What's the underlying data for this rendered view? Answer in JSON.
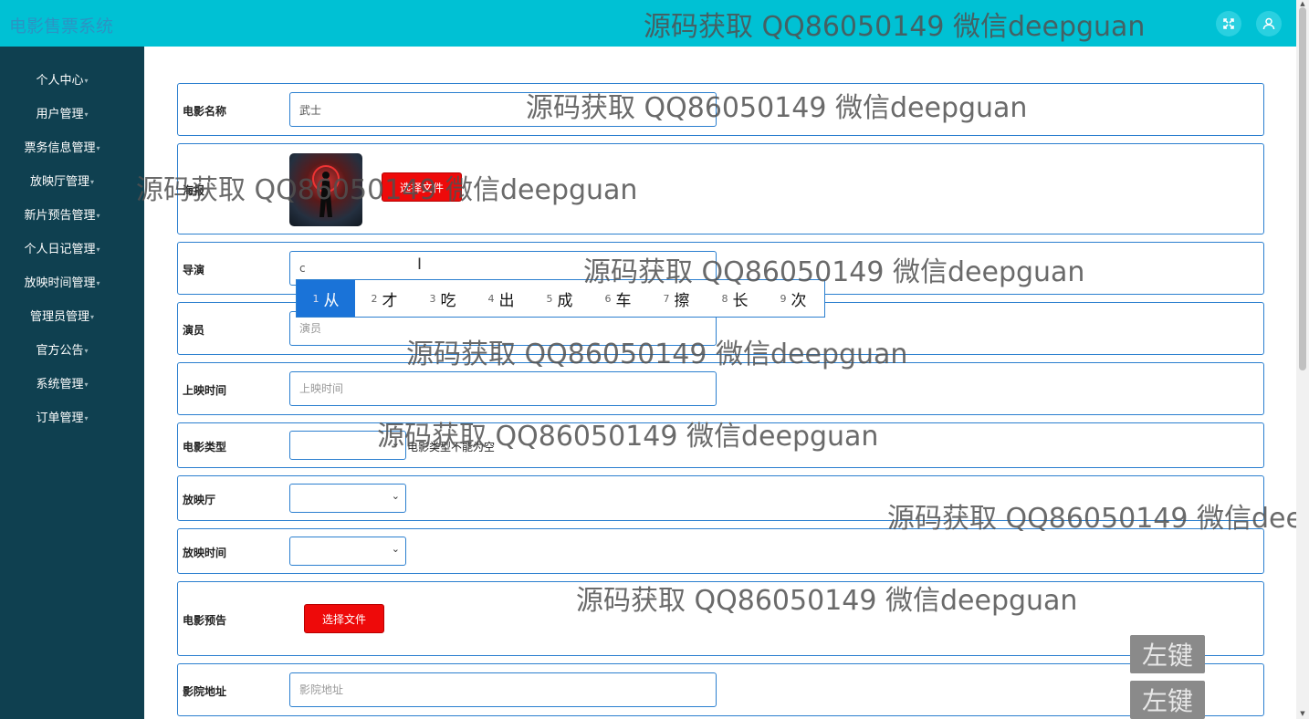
{
  "app": {
    "title": "电影售票系统"
  },
  "sidebar": {
    "items": [
      {
        "label": "个人中心"
      },
      {
        "label": "用户管理"
      },
      {
        "label": "票务信息管理"
      },
      {
        "label": "放映厅管理"
      },
      {
        "label": "新片预告管理"
      },
      {
        "label": "个人日记管理"
      },
      {
        "label": "放映时间管理"
      },
      {
        "label": "管理员管理"
      },
      {
        "label": "官方公告"
      },
      {
        "label": "系统管理"
      },
      {
        "label": "订单管理"
      }
    ]
  },
  "form": {
    "movie_name": {
      "label": "电影名称",
      "value": "武士"
    },
    "poster": {
      "label": "海报",
      "button": "选择文件"
    },
    "director": {
      "label": "导演",
      "value": "c"
    },
    "actors": {
      "label": "演员",
      "placeholder": "演员"
    },
    "release_time": {
      "label": "上映时间",
      "placeholder": "上映时间"
    },
    "movie_type": {
      "label": "电影类型",
      "error": "电影类型不能为空"
    },
    "hall": {
      "label": "放映厅"
    },
    "show_time": {
      "label": "放映时间"
    },
    "trailer": {
      "label": "电影预告",
      "button": "选择文件"
    },
    "cinema_address": {
      "label": "影院地址",
      "placeholder": "影院地址"
    }
  },
  "ime": {
    "candidates": [
      {
        "num": "1",
        "char": "从"
      },
      {
        "num": "2",
        "char": "才"
      },
      {
        "num": "3",
        "char": "吃"
      },
      {
        "num": "4",
        "char": "出"
      },
      {
        "num": "5",
        "char": "成"
      },
      {
        "num": "6",
        "char": "车"
      },
      {
        "num": "7",
        "char": "擦"
      },
      {
        "num": "8",
        "char": "长"
      },
      {
        "num": "9",
        "char": "次"
      }
    ]
  },
  "watermark": {
    "text": "源码获取 QQ86050149 微信deepguan",
    "text_cut": "源码获取 QQ86050149 微信deep"
  },
  "overlay": {
    "left_click": "左键"
  },
  "icons": {
    "fullscreen": "expand-icon",
    "user": "user-icon"
  },
  "colors": {
    "topbar": "#00c1d4",
    "sidebar": "#0f4050",
    "accent": "#2b7fcf",
    "button": "#ee0a0a"
  }
}
